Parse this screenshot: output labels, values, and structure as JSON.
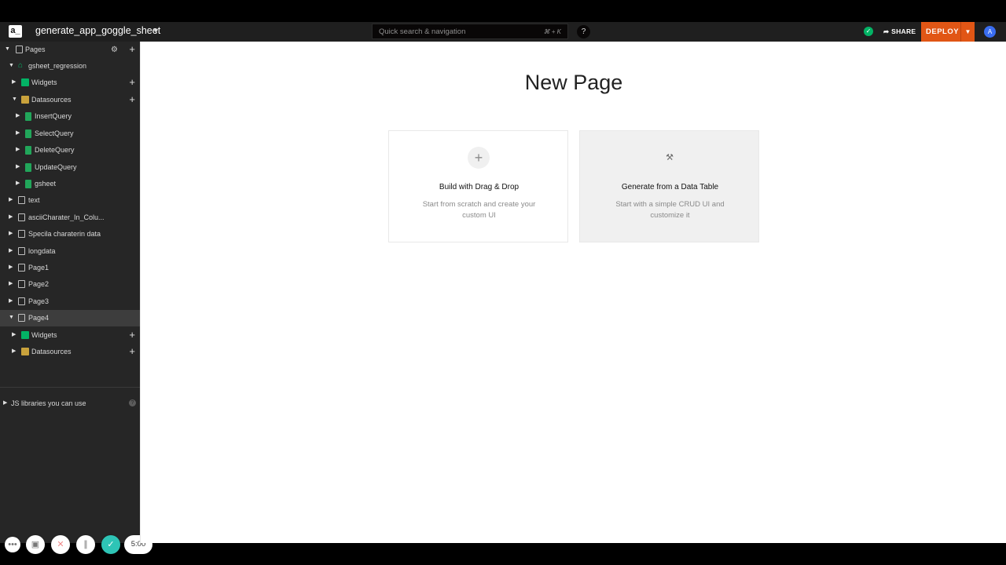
{
  "header": {
    "logo": "a_",
    "app_name": "generate_app_goggle_sheet",
    "search_placeholder": "Quick search & navigation",
    "search_shortcut": "⌘ + K",
    "help": "?",
    "share_label": "SHARE",
    "deploy_label": "DEPLOY",
    "avatar": "A"
  },
  "sidebar": {
    "pages_label": "Pages",
    "items": [
      {
        "label": "gsheet_regression"
      },
      {
        "label": "Widgets"
      },
      {
        "label": "Datasources"
      },
      {
        "label": "InsertQuery"
      },
      {
        "label": "SelectQuery"
      },
      {
        "label": "DeleteQuery"
      },
      {
        "label": "UpdateQuery"
      },
      {
        "label": "gsheet"
      },
      {
        "label": "text"
      },
      {
        "label": "asciiCharater_In_Colu..."
      },
      {
        "label": "Specila charaterin data"
      },
      {
        "label": "longdata"
      },
      {
        "label": "Page1"
      },
      {
        "label": "Page2"
      },
      {
        "label": "Page3"
      },
      {
        "label": "Page4"
      },
      {
        "label": "Widgets"
      },
      {
        "label": "Datasources"
      }
    ],
    "js_libraries": "JS libraries you can use"
  },
  "recorder": {
    "timer": "5:00"
  },
  "main": {
    "title": "New Page",
    "cards": [
      {
        "title": "Build with Drag & Drop",
        "description": "Start from scratch and create your custom UI"
      },
      {
        "title": "Generate from a Data Table",
        "description": "Start with a simple CRUD UI and customize it"
      }
    ]
  },
  "colors": {
    "deploy": "#e15615",
    "success": "#03b365",
    "sidebar_bg": "#262626",
    "header_bg": "#1f1f1f"
  }
}
